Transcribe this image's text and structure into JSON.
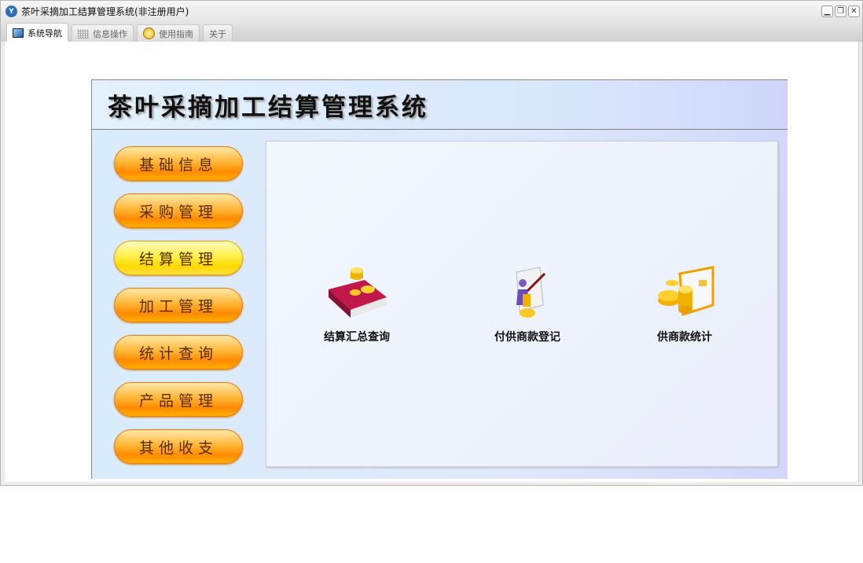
{
  "window": {
    "title": "茶叶采摘加工结算管理系统(非注册用户)",
    "app_icon": "Y",
    "controls": [
      "minimize",
      "restore",
      "close"
    ]
  },
  "tabs": [
    {
      "label": "系统导航",
      "icon": "monitor-icon"
    },
    {
      "label": "信息操作",
      "icon": "grid-icon"
    },
    {
      "label": "使用指南",
      "icon": "help-icon"
    },
    {
      "label": "关于"
    }
  ],
  "header": {
    "title": "茶叶采摘加工结算管理系统"
  },
  "nav": [
    {
      "label": "基础信息"
    },
    {
      "label": "采购管理"
    },
    {
      "label": "结算管理",
      "active": true
    },
    {
      "label": "加工管理"
    },
    {
      "label": "统计查询"
    },
    {
      "label": "产品管理"
    },
    {
      "label": "其他收支"
    }
  ],
  "functions": [
    {
      "label": "结算汇总查询",
      "icon": "ledger-coins-icon"
    },
    {
      "label": "付供商款登记",
      "icon": "person-payment-icon"
    },
    {
      "label": "供商款统计",
      "icon": "coins-document-icon"
    }
  ]
}
